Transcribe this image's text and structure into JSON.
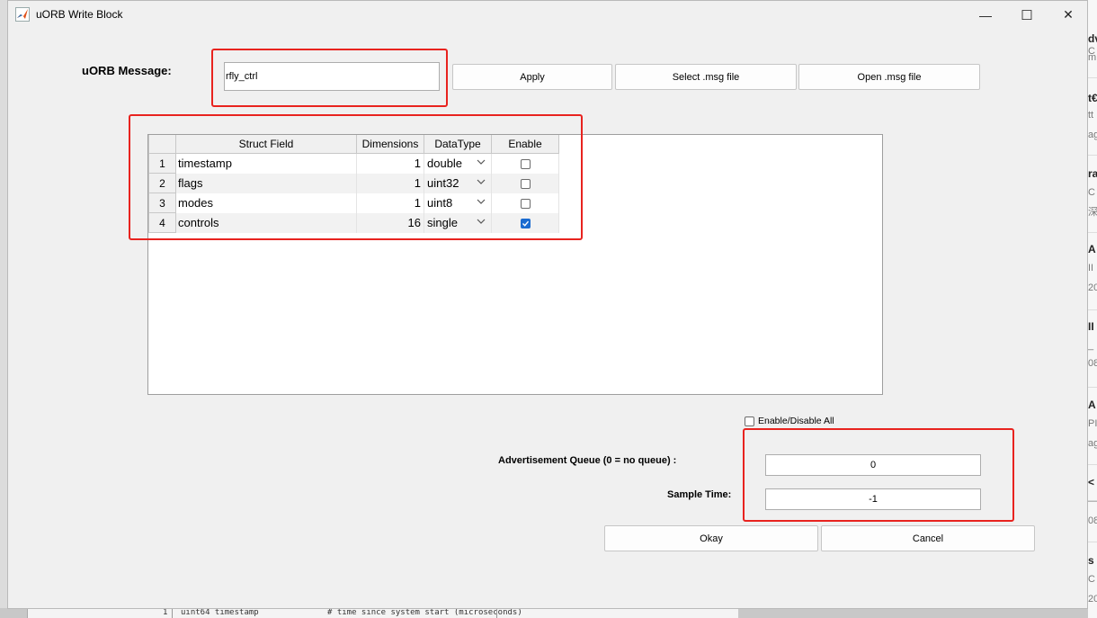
{
  "window": {
    "title": "uORB Write Block",
    "minimize_glyph": "—",
    "maximize_glyph": "☐",
    "close_glyph": "✕"
  },
  "message": {
    "label": "uORB Message:",
    "value": "rfly_ctrl"
  },
  "buttons": {
    "apply": "Apply",
    "select_msg": "Select .msg file",
    "open_msg": "Open .msg file",
    "okay": "Okay",
    "cancel": "Cancel"
  },
  "table": {
    "columns": [
      "Struct Field",
      "Dimensions",
      "DataType",
      "Enable"
    ],
    "rows": [
      {
        "index": "1",
        "field": "timestamp",
        "dimensions": "1",
        "datatype": "double",
        "enabled": false
      },
      {
        "index": "2",
        "field": "flags",
        "dimensions": "1",
        "datatype": "uint32",
        "enabled": false
      },
      {
        "index": "3",
        "field": "modes",
        "dimensions": "1",
        "datatype": "uint8",
        "enabled": false
      },
      {
        "index": "4",
        "field": "controls",
        "dimensions": "16",
        "datatype": "single",
        "enabled": true
      }
    ]
  },
  "enable_all": {
    "label": "Enable/Disable All",
    "checked": false
  },
  "advertisement_queue": {
    "label": "Advertisement Queue (0 = no queue) :",
    "value": "0"
  },
  "sample_time": {
    "label": "Sample Time:",
    "value": "-1"
  },
  "background": {
    "right_strip_glyphs": [
      "dv",
      "C",
      "m",
      "t€",
      "tt",
      "ag",
      "ra",
      "C",
      "深",
      "A",
      "II",
      "20",
      "II",
      "_",
      "08",
      "A",
      "PI",
      "ag",
      "<",
      "—",
      "08",
      "s",
      "C",
      "20"
    ],
    "bottom_code": [
      "1",
      "uint64 timestamp",
      "# time since system start (microseconds)"
    ]
  },
  "colors": {
    "highlight": "#e8231f",
    "checkbox_on": "#1a6bd0",
    "dialog_bg": "#f0f0f0"
  }
}
